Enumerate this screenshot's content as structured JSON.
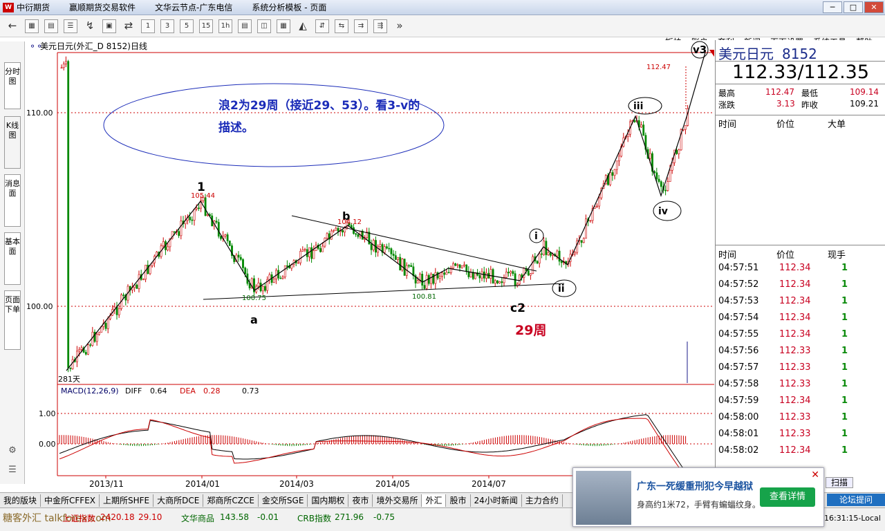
{
  "titlebar": {
    "items": [
      "中衍期货",
      "赢顺期货交易软件",
      "文华云节点-广东电信",
      "系统分析模板 - 页面"
    ],
    "minimize": "─",
    "maximize": "□",
    "close": "✕"
  },
  "toolbar": {
    "buttons": [
      "←",
      "▦",
      "▤",
      "☰",
      "↯",
      "▣",
      "⇄",
      "1",
      "3",
      "5",
      "15",
      "1h",
      "▤",
      "◫",
      "▦",
      "◭",
      "⇵",
      "⇆",
      "⇉",
      "⇶",
      "»"
    ],
    "menu": [
      "板块",
      "账户",
      "套利",
      "新闻",
      "页面设置",
      "系统工具",
      "帮助"
    ]
  },
  "sidetabs": [
    "分时图",
    "K线图",
    "消息面",
    "基本面",
    "页面下单"
  ],
  "chart": {
    "title": "美元日元(外汇_D 8152)日线",
    "y_labels": [
      "110.00",
      "100.00"
    ],
    "macd_title": "MACD(12,26,9)",
    "diff_label": "DIFF",
    "diff_value": "0.64",
    "dea_label": "DEA",
    "dea_value": "0.28",
    "macd_value": "0.73",
    "macd_y_labels": [
      "1.00",
      "0.00"
    ],
    "x_labels": [
      "2013/11",
      "2014/01",
      "2014/03",
      "2014/05",
      "2014/07"
    ],
    "annotation_text_line1": "浪2为29周（接近29、53）。看3-v的",
    "annotation_text_line2": "描述。",
    "wave_labels": {
      "w1": "1",
      "a": "a",
      "b": "b",
      "c2": "c2",
      "i": "i",
      "ii": "ii",
      "iii": "iii",
      "iv": "iv",
      "v3": "v3"
    },
    "price_labels": {
      "high1": "105.44",
      "b": "104.12",
      "a": "100.75",
      "low2": "100.81",
      "top": "112.47"
    },
    "weeks_label": "29周",
    "days_label": "281天",
    "colors": {
      "up": "#cc0000",
      "down": "#008800",
      "diff": "#000000",
      "dea": "#cc0000",
      "annot": "#1a2bb8",
      "grid": "#cc0000"
    }
  },
  "chart_data": {
    "type": "candlestick",
    "title": "美元日元(外汇_D 8152)日线",
    "x_ticks": [
      "2013/11",
      "2014/01",
      "2014/03",
      "2014/05",
      "2014/07"
    ],
    "y_ticks": [
      100.0,
      110.0
    ],
    "key_points": [
      {
        "label": "1",
        "value": 105.44
      },
      {
        "label": "a",
        "value": 100.75
      },
      {
        "label": "b",
        "value": 104.12
      },
      {
        "label": "c2",
        "value": 100.81
      },
      {
        "label": "top",
        "value": 112.47
      }
    ],
    "macd": {
      "diff": 0.64,
      "dea": 0.28,
      "macd": 0.73,
      "y_ticks": [
        0.0,
        1.0
      ]
    }
  },
  "info": {
    "name": "美元日元",
    "code": "8152",
    "price": "112.33/112.35",
    "high_label": "最高",
    "high": "112.47",
    "low_label": "最低",
    "low": "109.14",
    "chg_label": "涨跌",
    "chg": "3.13",
    "prev_label": "昨收",
    "prev": "109.21",
    "big_hdr": [
      "时间",
      "价位",
      "大单"
    ],
    "tick_hdr": [
      "时间",
      "价位",
      "现手"
    ],
    "ticks": [
      {
        "t": "04:57:51",
        "p": "112.34",
        "q": "1"
      },
      {
        "t": "04:57:52",
        "p": "112.34",
        "q": "1"
      },
      {
        "t": "04:57:53",
        "p": "112.34",
        "q": "1"
      },
      {
        "t": "04:57:54",
        "p": "112.34",
        "q": "1"
      },
      {
        "t": "04:57:55",
        "p": "112.34",
        "q": "1"
      },
      {
        "t": "04:57:56",
        "p": "112.33",
        "q": "1"
      },
      {
        "t": "04:57:57",
        "p": "112.33",
        "q": "1"
      },
      {
        "t": "04:57:58",
        "p": "112.33",
        "q": "1"
      },
      {
        "t": "04:57:59",
        "p": "112.34",
        "q": "1"
      },
      {
        "t": "04:58:00",
        "p": "112.33",
        "q": "1"
      },
      {
        "t": "04:58:01",
        "p": "112.33",
        "q": "1"
      },
      {
        "t": "04:58:02",
        "p": "112.34",
        "q": "1"
      }
    ],
    "scan_btn": "扫描"
  },
  "bottombar": [
    "我的版块",
    "中金所CFFEX",
    "上期所SHFE",
    "大商所DCE",
    "郑商所CZCE",
    "金交所SGE",
    "国内期权",
    "夜市",
    "境外交易所",
    "外汇",
    "股市",
    "24小时新闻",
    "主力合约"
  ],
  "statusbar": {
    "idx1_name": "上证指数",
    "idx1_val": "2420.18",
    "idx1_chg": "29.10",
    "idx2_name": "文华商品",
    "idx2_val": "143.58",
    "idx2_chg": "-0.01",
    "idx3_name": "CRB指数",
    "idx3_val": "271.96",
    "idx3_chg": "-0.75",
    "time": "16:31:15-Local",
    "watermark": "糖客外汇 talkforex.com"
  },
  "ad": {
    "headline": "广东一死缓重刑犯今早越狱",
    "desc": "身高约1米72，手臂有蝙蝠纹身。",
    "button": "查看详情",
    "close": "✕"
  },
  "forum": "论坛提问"
}
